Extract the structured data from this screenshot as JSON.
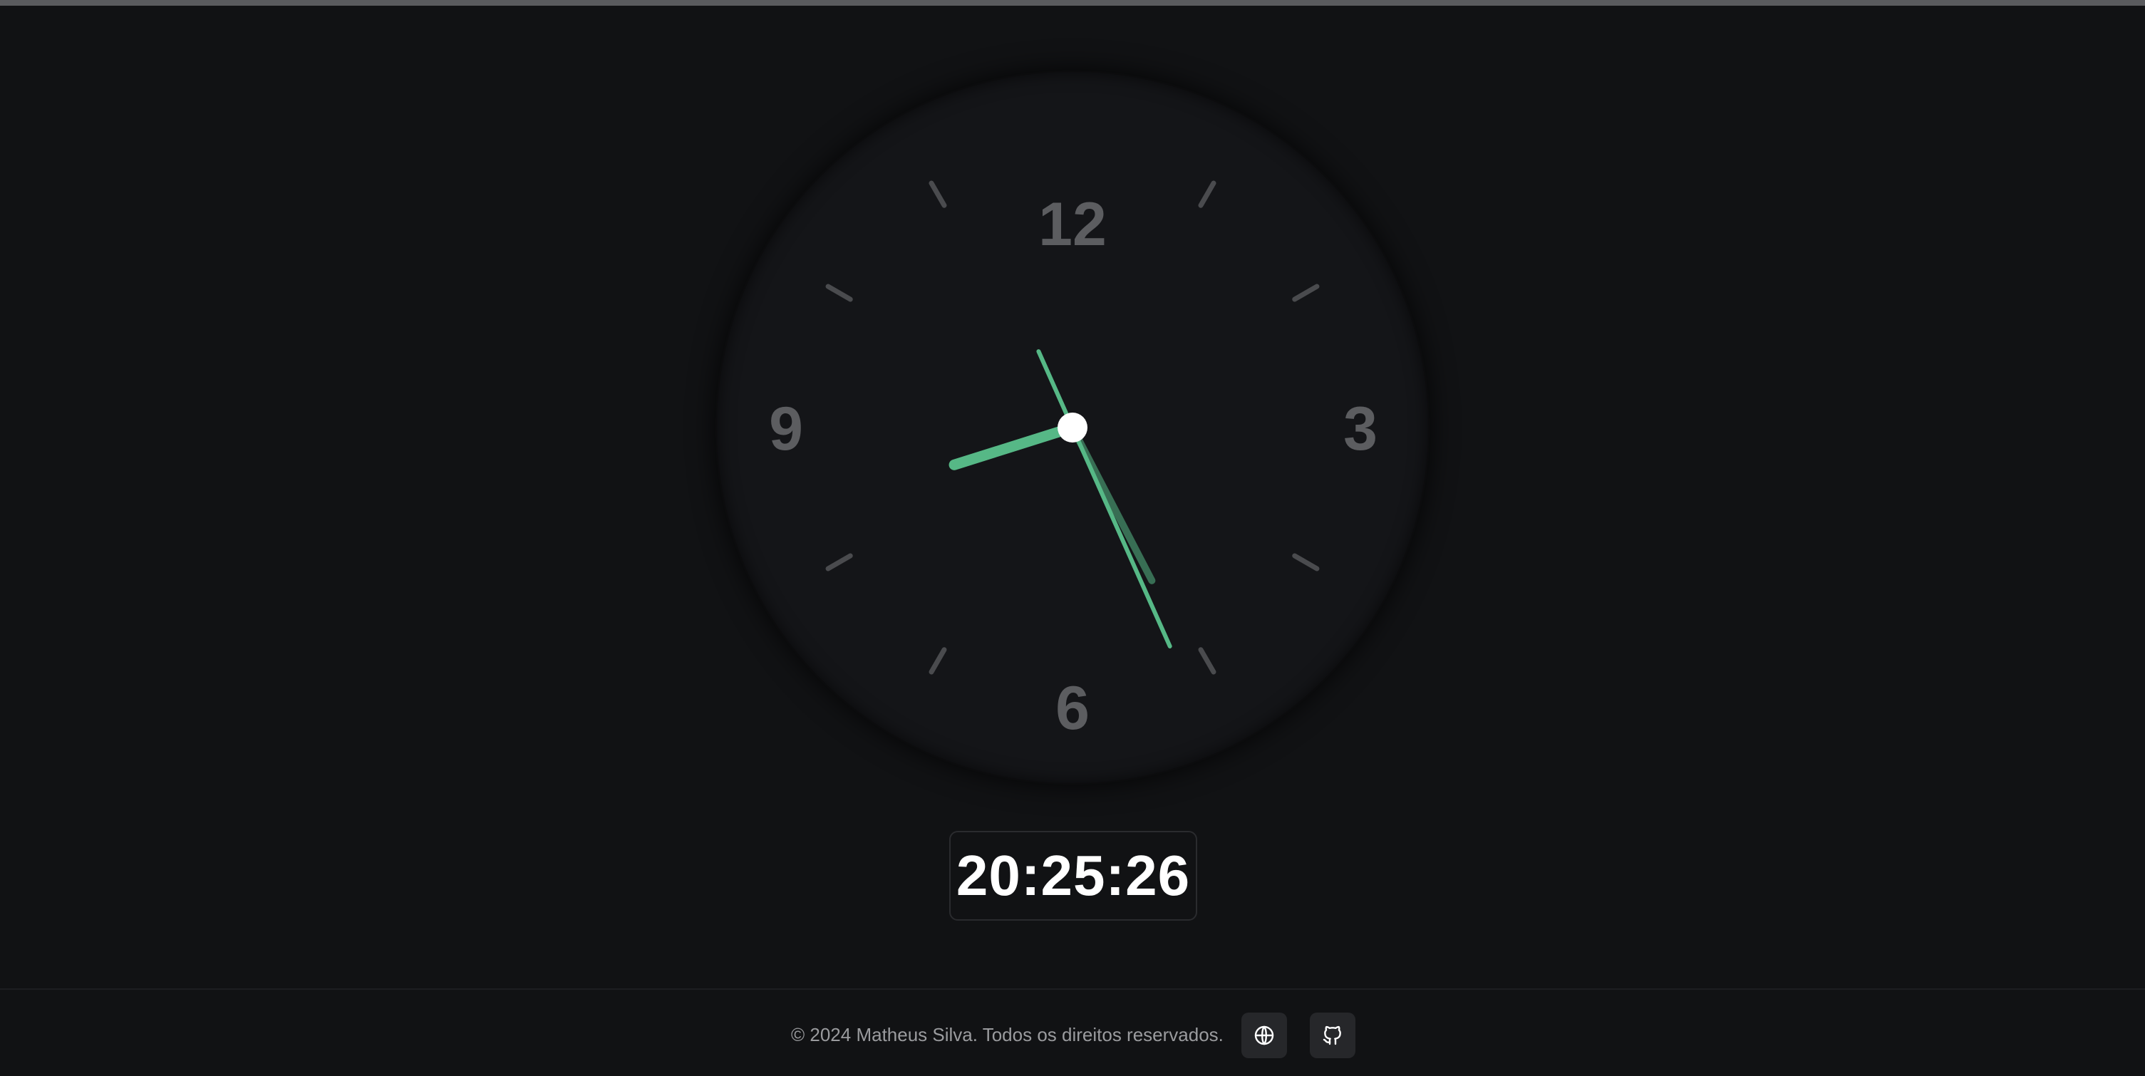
{
  "clock": {
    "numerals": [
      "12",
      "3",
      "6",
      "9"
    ],
    "hand_color": "#56b886",
    "time": {
      "hours": 20,
      "minutes": 25,
      "seconds": 26
    }
  },
  "digital_time": "20:25:26",
  "footer": {
    "copyright": "© 2024 Matheus Silva. Todos os direitos reservados.",
    "buttons": [
      {
        "icon": "globe-icon"
      },
      {
        "icon": "github-icon"
      }
    ]
  },
  "colors": {
    "background": "#111214",
    "accent": "#56b886",
    "numeral": "#5c5d60",
    "text": "#9a9b9e"
  }
}
